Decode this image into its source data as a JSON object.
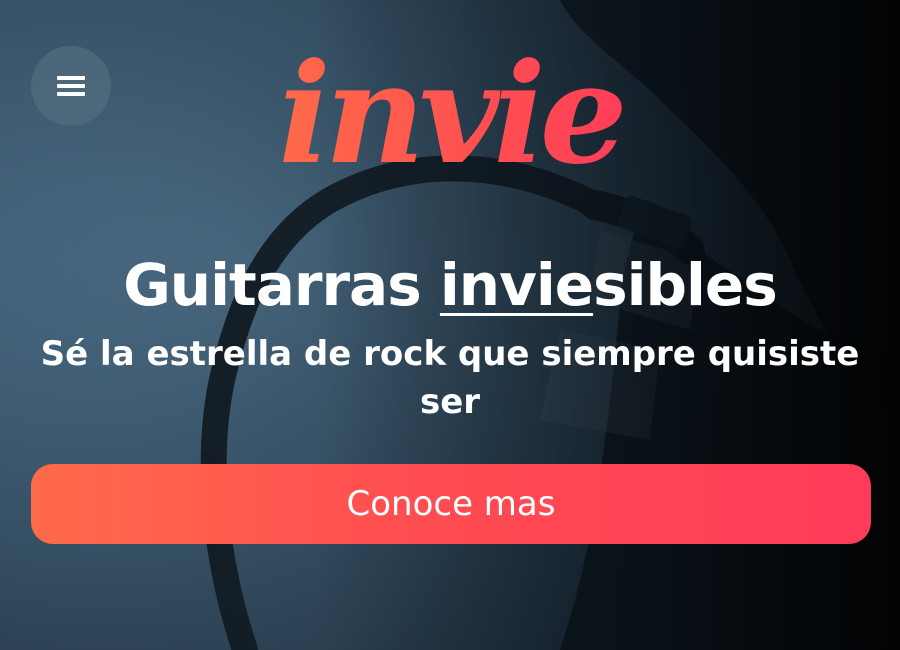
{
  "header": {
    "menu_icon": "hamburger-menu-icon",
    "logo_text": "invie"
  },
  "hero": {
    "headline_prefix": "Guitarras ",
    "headline_underlined": "invie",
    "headline_suffix": "sibles",
    "subtitle": "Sé la estrella de rock que siempre quisiste ser",
    "cta_label": "Conoce mas"
  },
  "colors": {
    "brand_orange": "#ff6a4a",
    "brand_pink": "#ff3b59",
    "background_blue": "#3a566c",
    "text": "#ffffff"
  }
}
